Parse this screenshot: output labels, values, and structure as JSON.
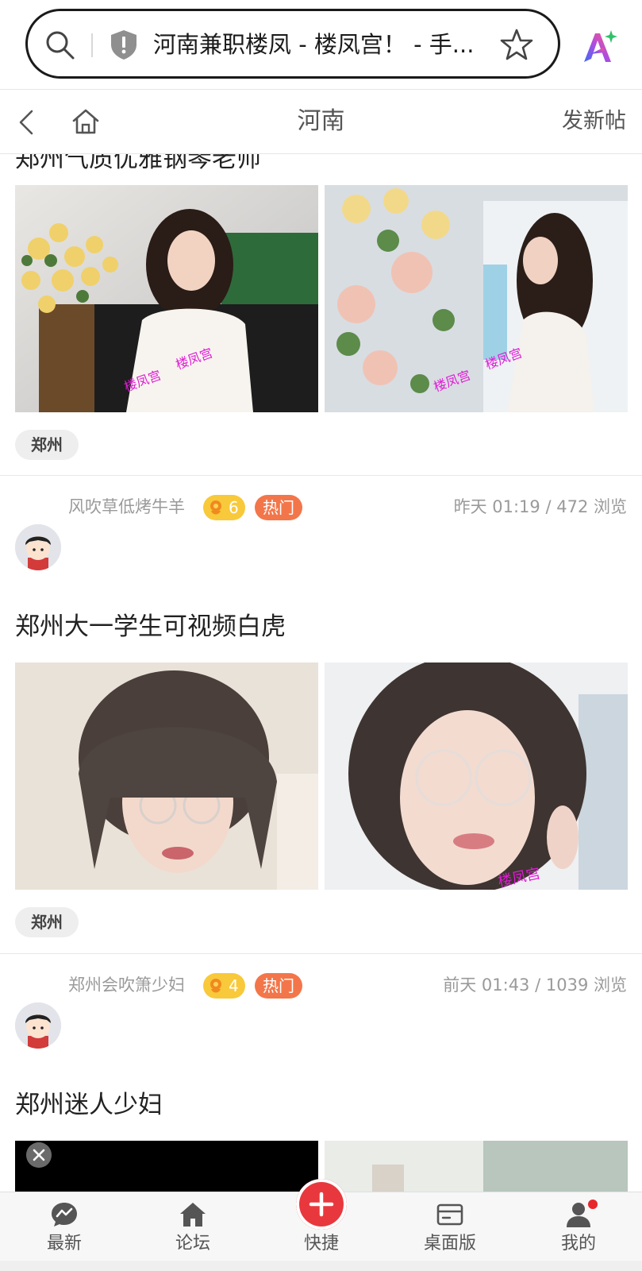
{
  "browser": {
    "url_text": "河南兼职楼凤 - 楼凤宫！ - 手..."
  },
  "nav": {
    "title": "河南",
    "new_post": "发新帖"
  },
  "posts": [
    {
      "title": "郑州气质优雅钢琴老师",
      "tag": "郑州",
      "watermark": "楼凤宫"
    },
    {
      "author": "风吹草低烤牛羊",
      "flower_count": "6",
      "hot_label": "热门",
      "time": "昨天 01:19",
      "views": "472 浏览",
      "title": "郑州大一学生可视频白虎",
      "tag": "郑州",
      "watermark": "楼凤宫"
    },
    {
      "author": "郑州会吹箫少妇",
      "flower_count": "4",
      "hot_label": "热门",
      "time": "前天 01:43",
      "views": "1039 浏览",
      "title": "郑州迷人少妇"
    }
  ],
  "tabbar": {
    "items": [
      {
        "label": "最新",
        "icon": "chat-icon"
      },
      {
        "label": "论坛",
        "icon": "home-icon"
      },
      {
        "label": "快捷",
        "icon": "plus-icon"
      },
      {
        "label": "桌面版",
        "icon": "desktop-icon"
      },
      {
        "label": "我的",
        "icon": "user-icon"
      }
    ]
  },
  "colors": {
    "accent": "#e8383d",
    "hot": "#f3764a",
    "flower": "#f8c93a"
  }
}
